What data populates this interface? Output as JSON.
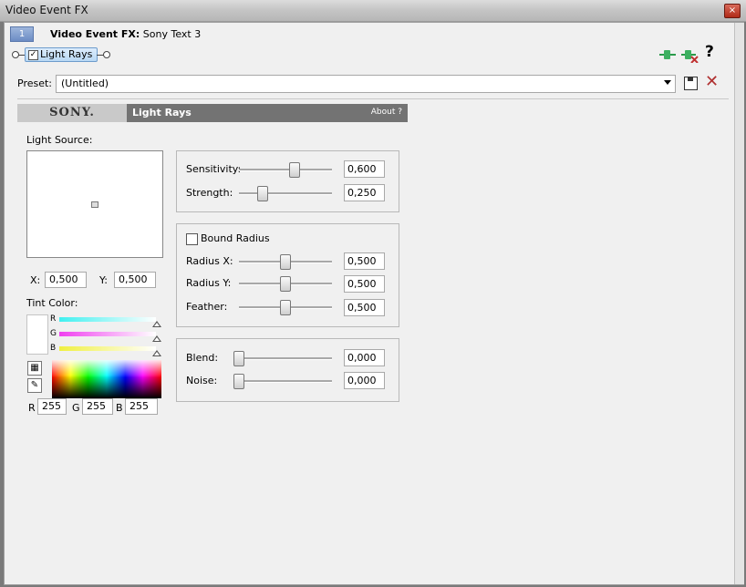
{
  "window": {
    "title": "Video Event FX",
    "close_glyph": "×"
  },
  "chain": {
    "tab_number": "1",
    "fx_label": "Video Event FX:",
    "fx_name": "Sony Text 3",
    "plugin_label": "Light Rays",
    "plugin_checked": "✓",
    "icons": [
      "plugin-chain-icon",
      "remove-plugin-icon",
      "help-icon"
    ],
    "help_glyph": "?"
  },
  "preset": {
    "label": "Preset:",
    "value": "(Untitled)"
  },
  "header": {
    "logo": "SONY.",
    "title": "Light Rays",
    "about": "About  ?"
  },
  "light_source": {
    "label": "Light Source:",
    "x_label": "X:",
    "x_value": "0,500",
    "y_label": "Y:",
    "y_value": "0,500"
  },
  "tint": {
    "label": "Tint Color:",
    "channels": [
      "R",
      "G",
      "B"
    ],
    "r_label": "R",
    "r_value": "255",
    "g_label": "G",
    "g_value": "255",
    "b_label": "B",
    "b_value": "255"
  },
  "group1": {
    "sensitivity_label": "Sensitivity:",
    "sensitivity_value": "0,600",
    "sensitivity_level": 0.6,
    "strength_label": "Strength:",
    "strength_value": "0,250",
    "strength_level": 0.25
  },
  "group2": {
    "bound_radius_label": "Bound Radius",
    "radius_x_label": "Radius X:",
    "radius_x_value": "0,500",
    "radius_x_level": 0.5,
    "radius_y_label": "Radius Y:",
    "radius_y_value": "0,500",
    "radius_y_level": 0.5,
    "feather_label": "Feather:",
    "feather_value": "0,500",
    "feather_level": 0.5
  },
  "group3": {
    "blend_label": "Blend:",
    "blend_value": "0,000",
    "blend_level": 0,
    "noise_label": "Noise:",
    "noise_value": "0,000",
    "noise_level": 0
  }
}
